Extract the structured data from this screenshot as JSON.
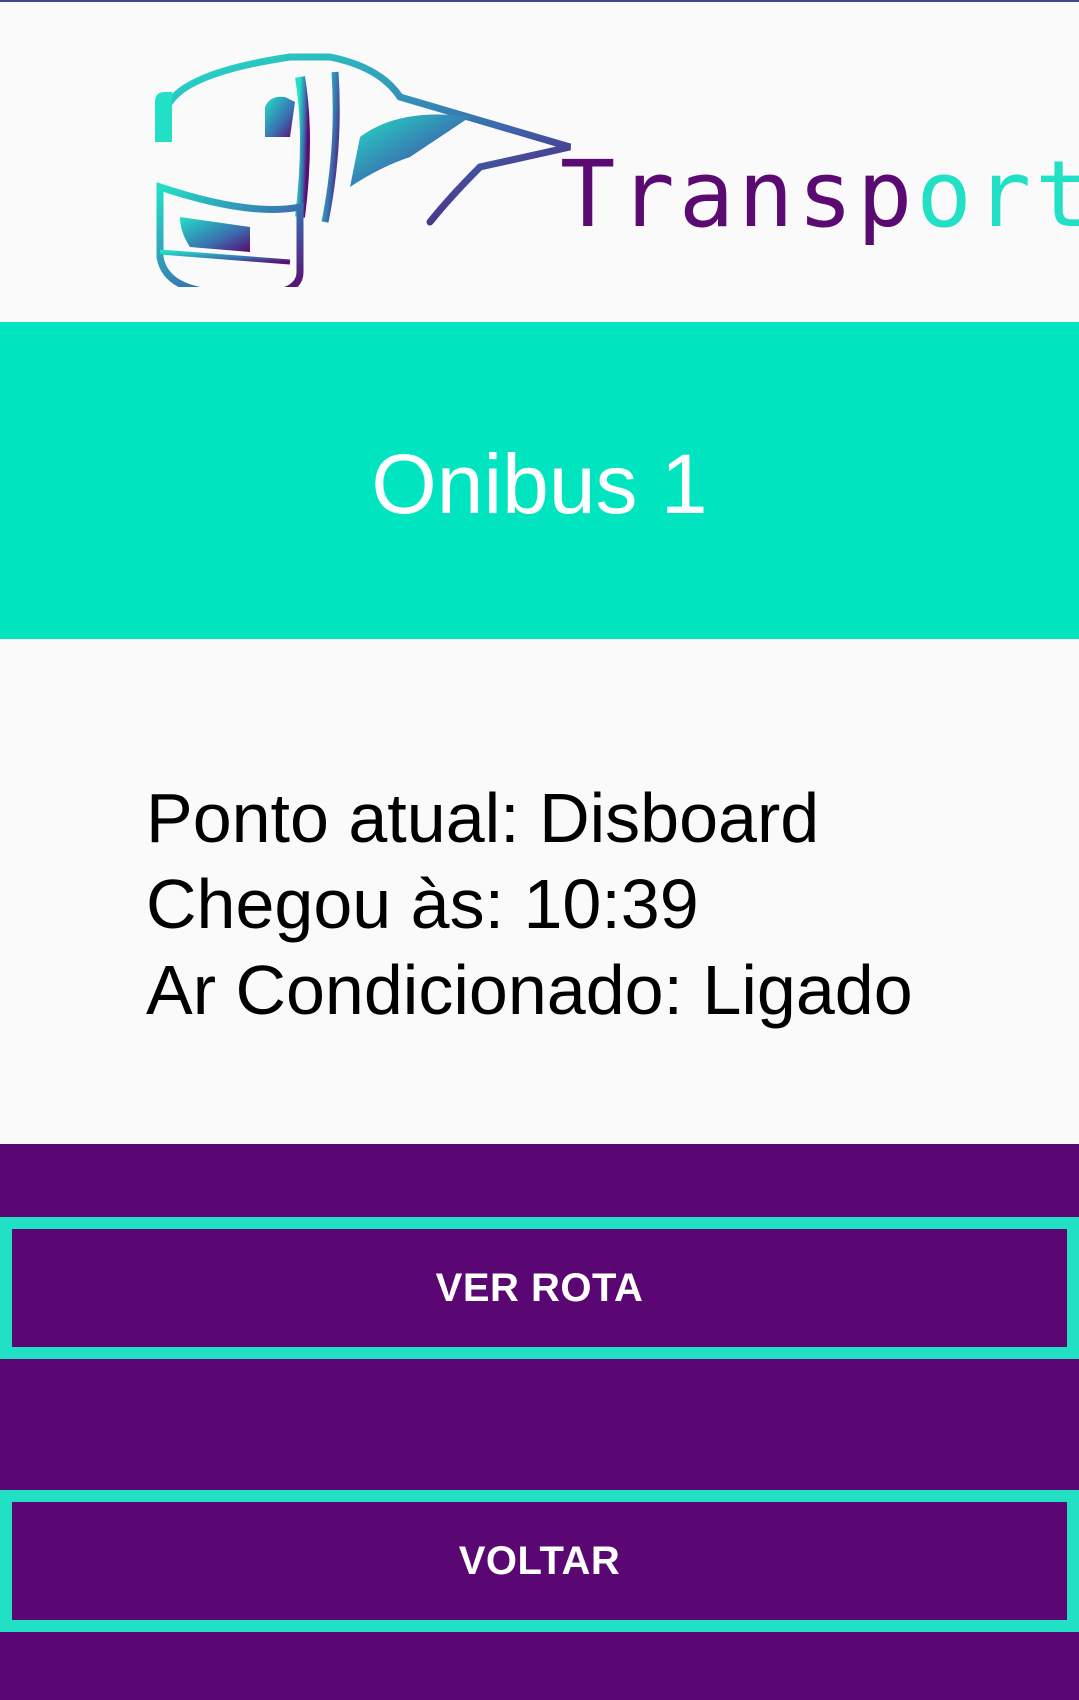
{
  "logo": {
    "text_main": "Transp",
    "text_accent": "ort"
  },
  "bus": {
    "title": "Onibus 1"
  },
  "info": {
    "ponto_atual": "Ponto atual: Disboard",
    "chegou": "Chegou às: 10:39",
    "ar_condicionado": "Ar Condicionado: Ligado"
  },
  "actions": {
    "ver_rota": "VER ROTA",
    "voltar": "VOLTAR"
  },
  "colors": {
    "teal": "#00e5c0",
    "purple": "#5a0673",
    "background": "#fafafa"
  }
}
